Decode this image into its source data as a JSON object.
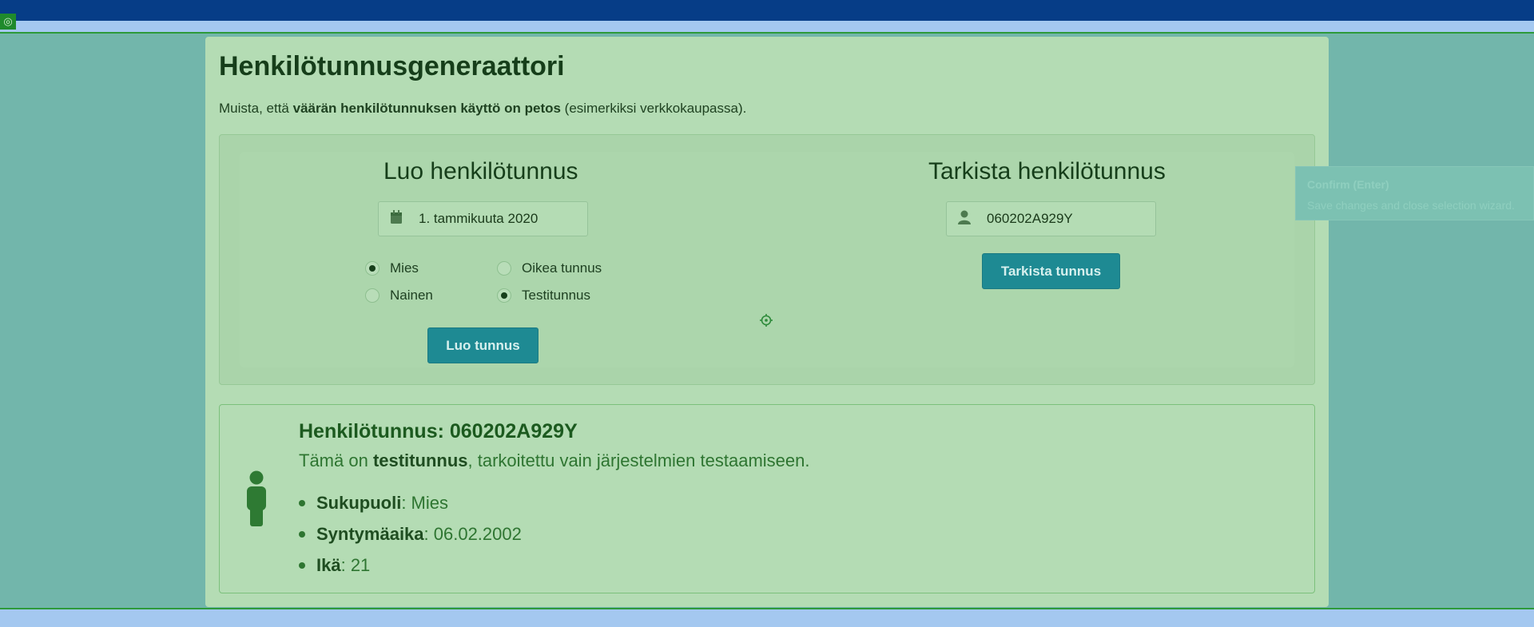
{
  "page": {
    "title": "Henkilötunnusgeneraattori",
    "notice": {
      "prefix": "Muista, että ",
      "bold": "väärän henkilötunnuksen käyttö on petos",
      "suffix": " (esimerkiksi verkkokaupassa)."
    }
  },
  "generate": {
    "heading": "Luo henkilötunnus",
    "date_value": "1. tammikuuta 2020",
    "date_icon": "calendar-icon",
    "gender_options": [
      {
        "label": "Mies",
        "selected": true
      },
      {
        "label": "Nainen",
        "selected": false
      }
    ],
    "type_options": [
      {
        "label": "Oikea tunnus",
        "selected": false
      },
      {
        "label": "Testitunnus",
        "selected": true
      }
    ],
    "button_label": "Luo tunnus"
  },
  "check": {
    "heading": "Tarkista henkilötunnus",
    "input_value": "060202A929Y",
    "input_icon": "user-icon",
    "button_label": "Tarkista tunnus"
  },
  "tooltip": {
    "title": "Confirm (Enter)",
    "text": "Save changes and close selection wizard."
  },
  "result": {
    "title": "Henkilötunnus: 060202A929Y",
    "desc_prefix": "Tämä on ",
    "desc_bold": "testitunnus",
    "desc_suffix": ", tarkoitettu vain järjestelmien testaamiseen.",
    "icon": "person-icon",
    "items": [
      {
        "label": "Sukupuoli",
        "value": ": Mies"
      },
      {
        "label": "Syntymäaika",
        "value": ": 06.02.2002"
      },
      {
        "label": "Ikä",
        "value": ": 21"
      }
    ]
  },
  "colors": {
    "accent_button": "#1e8a93",
    "topbar": "#063d87",
    "overlay": "#72b6ab",
    "card": "#b4dcb4"
  }
}
